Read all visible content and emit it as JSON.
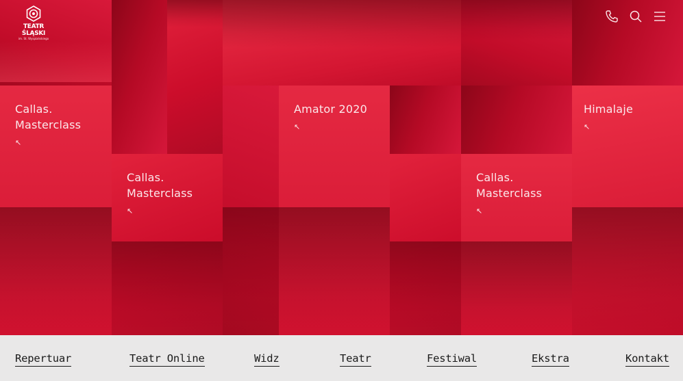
{
  "brand": {
    "name": "TEATR ŚLĄSKI",
    "subtitle": "im. St. Wyspiańskiego"
  },
  "header_icons": [
    "phone-icon",
    "search-icon",
    "menu-icon"
  ],
  "tiles": [
    {
      "title": "Callas.\nMasterclass",
      "arrow": "↖"
    },
    {
      "title": "Callas.\nMasterclass",
      "arrow": "↖"
    },
    {
      "title": "Amator 2020",
      "arrow": "↖"
    },
    {
      "title": "Callas.\nMasterclass",
      "arrow": "↖"
    },
    {
      "title": "Himalaje",
      "arrow": "↖"
    }
  ],
  "nav": [
    "Repertuar",
    "Teatr Online",
    "Widz",
    "Teatr",
    "Festiwal",
    "Ekstra",
    "Kontakt"
  ],
  "colors": {
    "accent": "#c8102e",
    "nav_bg": "#e9e8e8",
    "nav_text": "#1a1a1a"
  }
}
